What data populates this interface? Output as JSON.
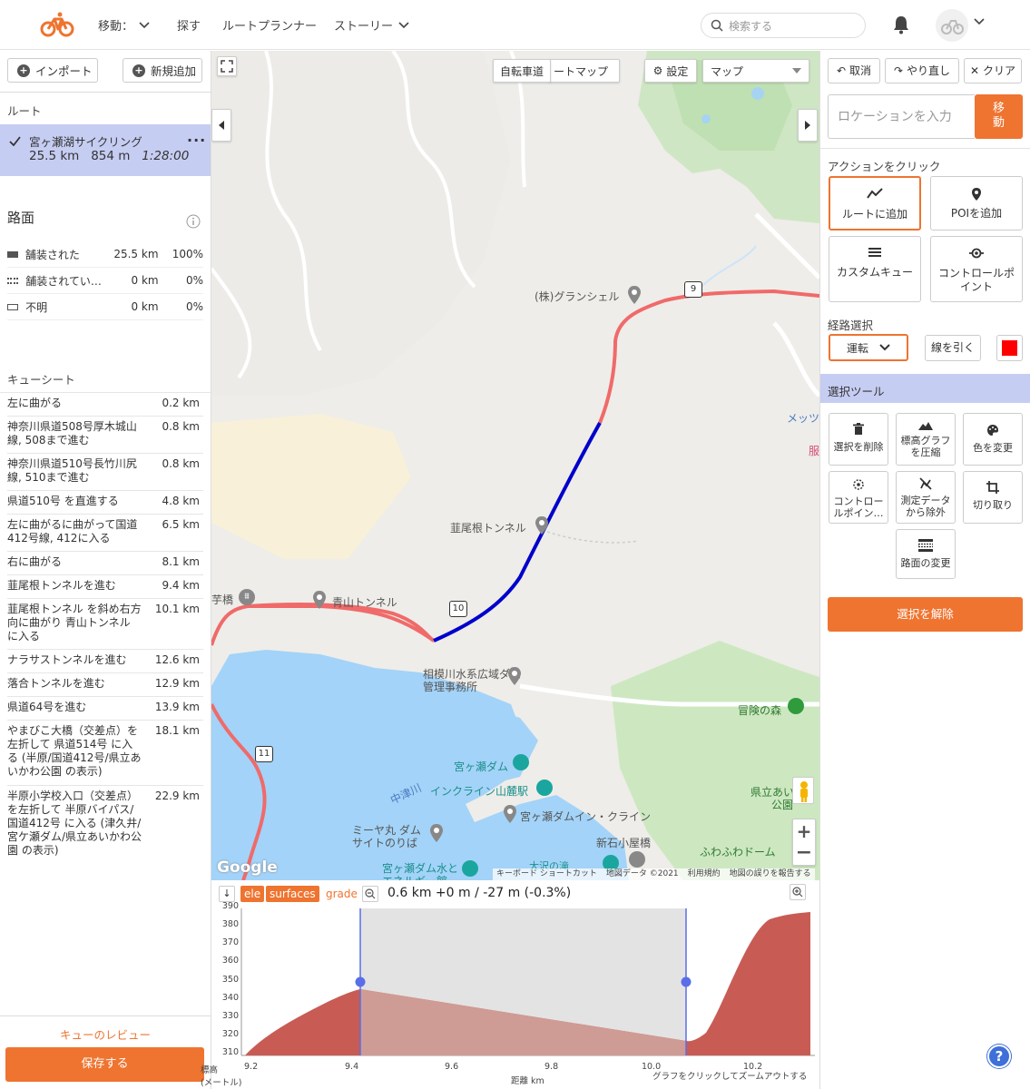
{
  "nav": {
    "items": [
      {
        "label": "移動：",
        "chevron": true
      },
      {
        "label": "探す",
        "chevron": false
      },
      {
        "label": "ルートプランナー",
        "chevron": false
      },
      {
        "label": "ストーリー",
        "chevron": true
      }
    ],
    "search_placeholder": "検索する"
  },
  "left": {
    "import_label": "インポート",
    "new_label": "新規追加",
    "route_header": "ルート",
    "route": {
      "name": "宮ヶ瀬湖サイクリング",
      "distance": "25.5 km",
      "elevation": "854 m",
      "time": "1:28:00"
    },
    "surface_title": "路面",
    "surfaces": [
      {
        "name": "舗装された",
        "dist": "25.5 km",
        "pct": "100%"
      },
      {
        "name": "舗装されてい…",
        "dist": "0 km",
        "pct": "0%"
      },
      {
        "name": "不明",
        "dist": "0 km",
        "pct": "0%"
      }
    ],
    "cue_title": "キューシート",
    "cues": [
      {
        "text": "左に曲がる",
        "dist": "0.2 km"
      },
      {
        "text": "神奈川県道508号厚木城山線, 508まで進む",
        "dist": "0.8 km"
      },
      {
        "text": "神奈川県道510号長竹川尻線, 510まで進む",
        "dist": "0.8 km"
      },
      {
        "text": "県道510号 を直進する",
        "dist": "4.8 km"
      },
      {
        "text": "左に曲がるに曲がって国道412号線, 412に入る",
        "dist": "6.5 km"
      },
      {
        "text": "右に曲がる",
        "dist": "8.1 km"
      },
      {
        "text": "韮尾根トンネルを進む",
        "dist": "9.4 km"
      },
      {
        "text": "韮尾根トンネル を斜め右方向に曲がり 青山トンネル に入る",
        "dist": "10.1 km"
      },
      {
        "text": "ナラサストンネルを進む",
        "dist": "12.6 km"
      },
      {
        "text": "落合トンネルを進む",
        "dist": "12.9 km"
      },
      {
        "text": "県道64号を進む",
        "dist": "13.9 km"
      },
      {
        "text": "やまびこ大橋（交差点）を左折して 県道514号 に入る (半原/国道412号/県立あいかわ公園 の表示)",
        "dist": "18.1 km"
      },
      {
        "text": "半原小学校入口（交差点）を左折して 半原バイパス/国道412号 に入る (津久井/宮ケ瀬ダム/県立あいかわ公園 の表示)",
        "dist": "22.9 km"
      }
    ],
    "review_label": "キューのレビュー",
    "save_label": "保存する"
  },
  "map": {
    "bike_lane_label": "自転車道",
    "shortcut_map_label": "ートマップ",
    "settings_label": "設定",
    "map_type": "マップ",
    "labels": {
      "gransiel": "(株)グランシェル",
      "nirao_tunnel": "韮尾根トンネル",
      "aoyama_tunnel": "青山トンネル",
      "imobashi": "芋橋",
      "dam_office": "相模川水系広域ダム管理事務所",
      "miyagase_dam": "宮ヶ瀬ダム",
      "incline_station": "インクライン山麓駅",
      "dam_incline": "宮ヶ瀬ダムイン・クライン",
      "nakatsugawa": "中津川",
      "miyamaru": "ミーヤ丸 ダムサイトのりば",
      "shinishigoya": "新石小屋橋",
      "bouken": "冒険の森",
      "kenritsu": "県立あい",
      "koen": "公園",
      "fuwafuwa": "ふわふわドーム",
      "energy1": "宮ヶ瀬ダム水と",
      "energy2": "エネルギー館",
      "ozawa": "大沢の滝",
      "metsu": "メッツ",
      "fuku": "服"
    },
    "road_shields": [
      "9",
      "10",
      "11"
    ],
    "google": "Google",
    "attribution": [
      "キーボード ショートカット",
      "地図データ ©2021",
      "利用規約",
      "地図の誤りを報告する"
    ]
  },
  "elevation": {
    "tabs": {
      "ele": "ele",
      "surfaces": "surfaces",
      "grade": "grade"
    },
    "summary": "0.6 km +0 m / -27 m (-0.3%)",
    "y_ticks": [
      "390",
      "380",
      "370",
      "360",
      "350",
      "340",
      "330",
      "320",
      "310"
    ],
    "x_ticks": [
      "9.2",
      "9.4",
      "9.6",
      "9.8",
      "10.0",
      "10.2"
    ],
    "ylabel1": "標高",
    "ylabel2": "(メートル)",
    "xlabel": "距離 km",
    "zoom_hint": "グラフをクリックしてズームアウトする"
  },
  "right": {
    "undo_label": "取消",
    "redo_label": "やり直し",
    "clear_label": "クリア",
    "location_placeholder": "ロケーションを入力",
    "go_label": "移動",
    "action_title": "アクションをクリック",
    "actions": [
      "ルートに追加",
      "POIを追加",
      "カスタムキュー",
      "コントロールポイント"
    ],
    "route_select_title": "経路選択",
    "mode": "運転",
    "draw_line_label": "線を引く",
    "line_color": "#ff0000",
    "tools_title": "選択ツール",
    "tools": [
      "選択を削除",
      "標高グラフを圧縮",
      "色を変更",
      "コントロールポイン…",
      "測定データから除外",
      "切り取り",
      "路面の変更"
    ],
    "deselect_label": "選択を解除"
  },
  "colors": {
    "accent": "#ee7430",
    "route": "#f06a6a",
    "selection": "#0000cc"
  }
}
